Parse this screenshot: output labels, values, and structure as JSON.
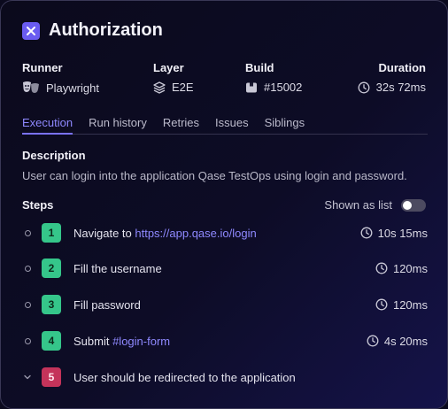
{
  "title": "Authorization",
  "meta": {
    "runner": {
      "label": "Runner",
      "value": "Playwright"
    },
    "layer": {
      "label": "Layer",
      "value": "E2E"
    },
    "build": {
      "label": "Build",
      "value": "#15002"
    },
    "duration": {
      "label": "Duration",
      "value": "32s 72ms"
    }
  },
  "tabs": [
    "Execution",
    "Run history",
    "Retries",
    "Issues",
    "Siblings"
  ],
  "active_tab": "Execution",
  "description": {
    "title": "Description",
    "text": "User can login into the application Qase TestOps using login and password."
  },
  "steps": {
    "title": "Steps",
    "shown_as_list_label": "Shown as list",
    "shown_as_list_enabled": false,
    "items": [
      {
        "num": "1",
        "text": "Navigate to ",
        "link": "https://app.qase.io/login",
        "duration": "10s 15ms",
        "status": "passed"
      },
      {
        "num": "2",
        "text": "Fill the username",
        "duration": "120ms",
        "status": "passed"
      },
      {
        "num": "3",
        "text": "Fill password",
        "duration": "120ms",
        "status": "passed"
      },
      {
        "num": "4",
        "text": "Submit ",
        "link": "#login-form",
        "duration": "4s 20ms",
        "status": "passed"
      },
      {
        "num": "5",
        "text": "User should be redirected to the application",
        "status": "failed"
      }
    ]
  },
  "colors": {
    "accent": "#7a72ff",
    "passed": "#35c68a",
    "failed": "#c4335a"
  }
}
